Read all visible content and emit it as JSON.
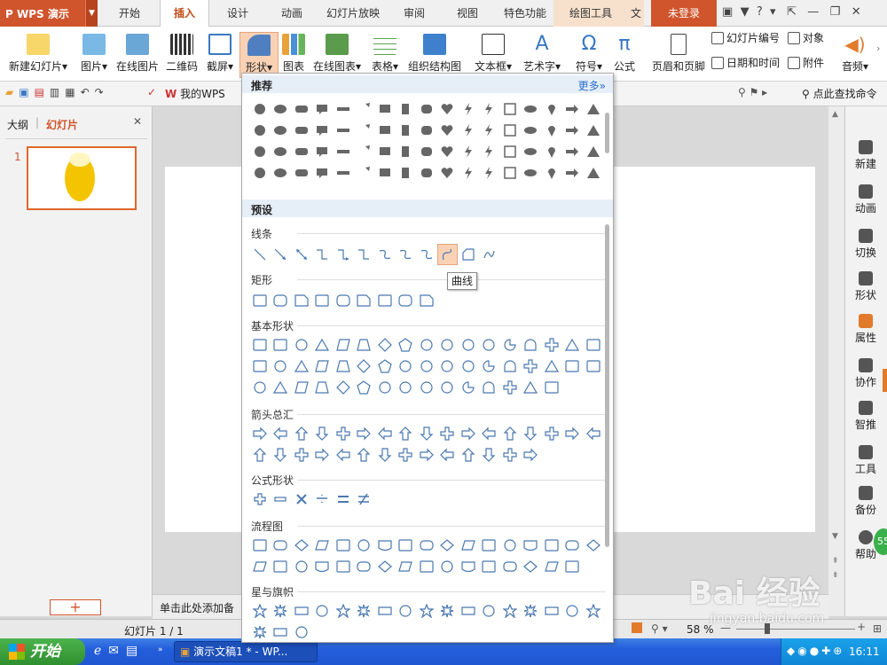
{
  "app": {
    "title": "WPS 演示"
  },
  "tabs": [
    "开始",
    "插入",
    "设计",
    "动画",
    "幻灯片放映",
    "审阅",
    "视图",
    "特色功能",
    "绘图工具",
    "文"
  ],
  "login": "未登录",
  "ribbon": {
    "new_slide": "新建幻灯片",
    "picture": "图片",
    "online_picture": "在线图片",
    "qrcode": "二维码",
    "screenshot": "截屏",
    "shape": "形状",
    "chart": "图表",
    "online_chart": "在线图表",
    "table": "表格",
    "smartart": "组织结构图",
    "textbox": "文本框",
    "wordart": "艺术字",
    "symbol": "符号",
    "formula": "公式",
    "header_footer": "页眉和页脚",
    "slide_number": "幻灯片编号",
    "object": "对象",
    "datetime": "日期和时间",
    "attachment": "附件",
    "audio": "音频"
  },
  "quickbar": {
    "my_wps": "我的WPS",
    "search": "点此查找命令"
  },
  "left_panel": {
    "tab_outline": "大纲",
    "tab_slides": "幻灯片",
    "slide_no": "1"
  },
  "notes_placeholder": "单击此处添加备",
  "right_panel": [
    "新建",
    "动画",
    "切换",
    "形状",
    "属性",
    "协作",
    "智推",
    "工具",
    "备份",
    "帮助"
  ],
  "status": {
    "slide_info": "幻灯片 1 / 1",
    "zoom": "58 %"
  },
  "panel": {
    "recommended": "推荐",
    "more": "更多",
    "preset": "预设",
    "categories": [
      "线条",
      "矩形",
      "基本形状",
      "箭头总汇",
      "公式形状",
      "流程图",
      "星与旗帜"
    ],
    "tooltip": "曲线"
  },
  "taskbar": {
    "start": "开始",
    "window": "演示文稿1 * - WP...",
    "time": "16:11"
  },
  "watermark": {
    "brand": "Bai 经验",
    "url": "jingyan.baidu.com"
  },
  "badge": "55"
}
